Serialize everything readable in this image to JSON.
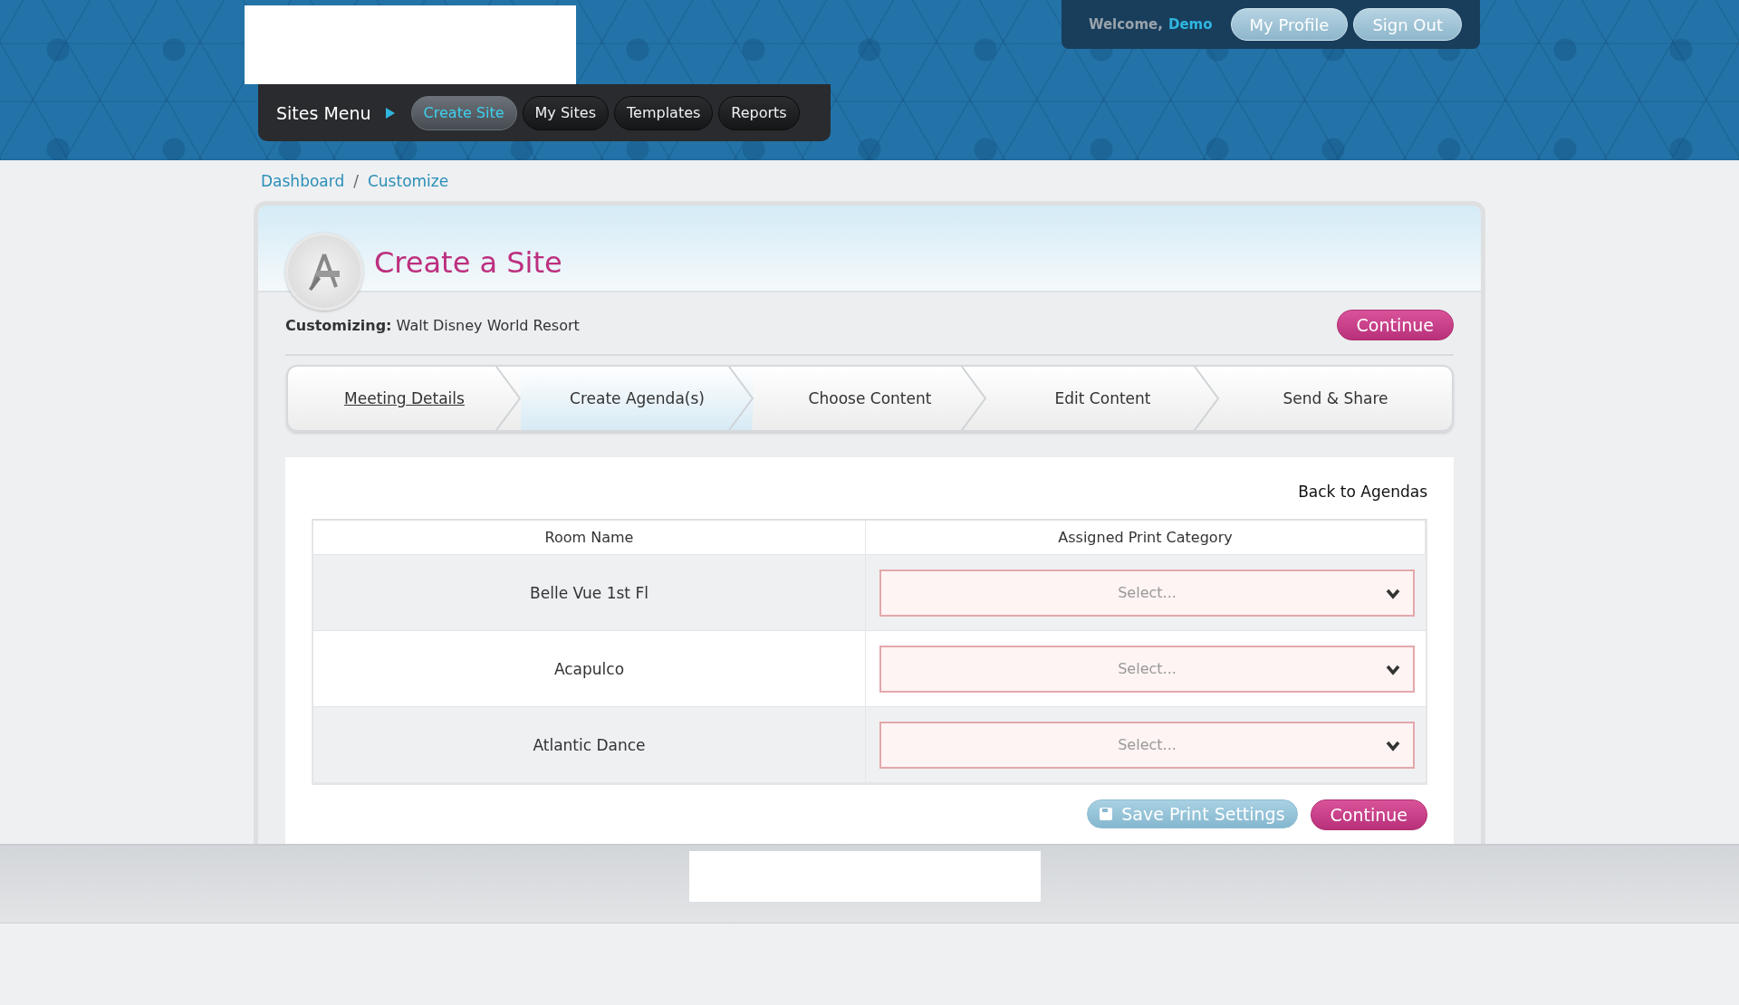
{
  "header": {
    "welcome_label": "Welcome,",
    "user_name": "Demo",
    "buttons": [
      "My Profile",
      "Sign Out"
    ]
  },
  "nav": {
    "title": "Sites Menu",
    "items": [
      {
        "label": "Create Site",
        "selected": true
      },
      {
        "label": "My Sites",
        "selected": false
      },
      {
        "label": "Templates",
        "selected": false
      },
      {
        "label": "Reports",
        "selected": false
      }
    ]
  },
  "breadcrumb": [
    "Dashboard",
    "Customize"
  ],
  "breadcrumb_separator": "/",
  "page": {
    "title": "Create a Site",
    "customizing_label": "Customizing:",
    "customizing_value": "Walt Disney World Resort",
    "continue_top": "Continue"
  },
  "wizard": [
    {
      "label": "Meeting Details",
      "selected": false,
      "underlined": true
    },
    {
      "label": "Create Agenda(s)",
      "selected": true,
      "underlined": false
    },
    {
      "label": "Choose Content",
      "selected": false,
      "underlined": false
    },
    {
      "label": "Edit Content",
      "selected": false,
      "underlined": false
    },
    {
      "label": "Send & Share",
      "selected": false,
      "underlined": false
    }
  ],
  "back_link": "Back to Agendas",
  "table": {
    "columns": [
      "Room Name",
      "Assigned Print Category"
    ],
    "rows": [
      {
        "room": "Belle Vue 1st Fl",
        "placeholder": "Select...",
        "invalid": true
      },
      {
        "room": "Acapulco",
        "placeholder": "Select...",
        "invalid": true
      },
      {
        "room": "Atlantic Dance",
        "placeholder": "Select...",
        "invalid": true
      }
    ]
  },
  "actions": {
    "save": "Save Print Settings",
    "continue": "Continue"
  }
}
